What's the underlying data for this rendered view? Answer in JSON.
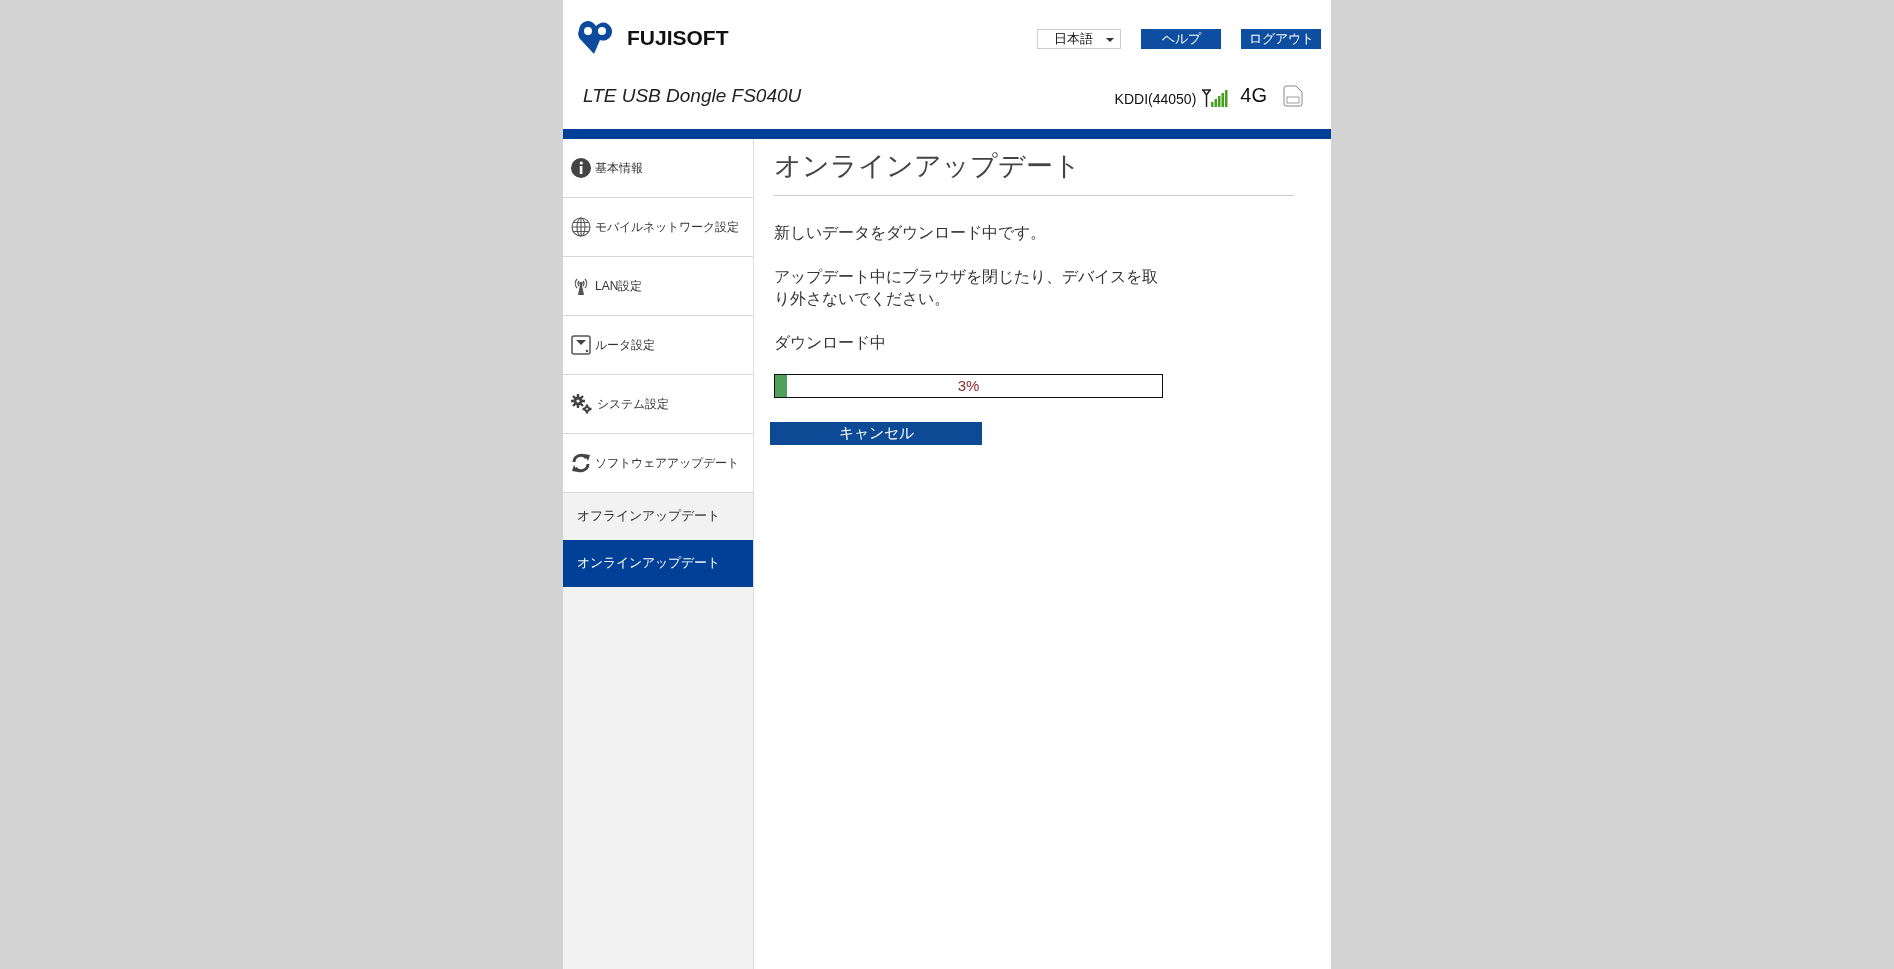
{
  "header": {
    "brand": "FUJISOFT",
    "product": "LTE USB Dongle FS040U",
    "language": "日本語",
    "buttons": [
      {
        "label": "ヘルプ"
      },
      {
        "label": "ログアウト"
      }
    ],
    "carrier": "KDDI(44050)",
    "network": "4G"
  },
  "sidebar": {
    "items": [
      {
        "label": "基本情報",
        "kind": "info"
      },
      {
        "label": "モバイルネットワーク設定",
        "kind": "globe"
      },
      {
        "label": "LAN設定",
        "kind": "antenna"
      },
      {
        "label": "ルータ設定",
        "kind": "router"
      },
      {
        "label": "システム設定",
        "kind": "gears"
      },
      {
        "label": "ソフトウェアアップデート",
        "kind": "refresh",
        "children": [
          {
            "label": "オフラインアップデート",
            "selected": false
          },
          {
            "label": "オンラインアップデート",
            "selected": true
          }
        ]
      }
    ]
  },
  "content": {
    "title": "オンラインアップデート",
    "messages": [
      "新しいデータをダウンロード中です。",
      "アップデート中にブラウザを閉じたり、デバイスを取り外さないでください。"
    ],
    "progress_label": "ダウンロード中",
    "progress": {
      "level": 0.03,
      "reading": "3%"
    },
    "cancel_button": "キャンセル"
  }
}
